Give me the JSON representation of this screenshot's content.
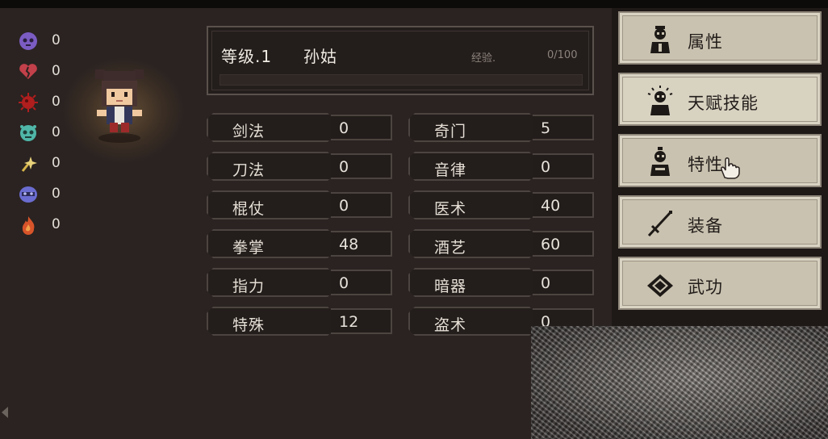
{
  "status_counters": [
    {
      "icon": "purple-skull-icon",
      "color": "#7b5cc2",
      "value": "0"
    },
    {
      "icon": "broken-heart-icon",
      "color": "#c2404a",
      "value": "0"
    },
    {
      "icon": "red-virus-icon",
      "color": "#b01e1e",
      "value": "0"
    },
    {
      "icon": "teal-skull-icon",
      "color": "#4fb6a8",
      "value": "0"
    },
    {
      "icon": "yellow-sparkle-icon",
      "color": "#d6b44a",
      "value": "0"
    },
    {
      "icon": "blue-mask-icon",
      "color": "#6a6cd0",
      "value": "0"
    },
    {
      "icon": "orange-flame-icon",
      "color": "#d8542a",
      "value": "0"
    }
  ],
  "header": {
    "level": "等级.1",
    "name": "孙姑",
    "exp_label": "经验.",
    "exp_value": "0/100",
    "exp_progress": 0
  },
  "skills_left": [
    {
      "label": "剑法",
      "value": "0"
    },
    {
      "label": "刀法",
      "value": "0"
    },
    {
      "label": "棍仗",
      "value": "0"
    },
    {
      "label": "拳掌",
      "value": "48"
    },
    {
      "label": "指力",
      "value": "0"
    },
    {
      "label": "特殊",
      "value": "12"
    }
  ],
  "skills_right": [
    {
      "label": "奇门",
      "value": "5"
    },
    {
      "label": "音律",
      "value": "0"
    },
    {
      "label": "医术",
      "value": "40"
    },
    {
      "label": "酒艺",
      "value": "60"
    },
    {
      "label": "暗器",
      "value": "0"
    },
    {
      "label": "盗术",
      "value": "0"
    }
  ],
  "menu": [
    {
      "label": "属性",
      "icon": "person-icon"
    },
    {
      "label": "天赋技能",
      "icon": "person-glow-icon"
    },
    {
      "label": "特性",
      "icon": "person-trait-icon"
    },
    {
      "label": "装备",
      "icon": "sword-icon"
    },
    {
      "label": "武功",
      "icon": "book-icon"
    }
  ],
  "colors": {
    "panel_bg": "#2a2321",
    "menu_bg": "#c9c2b0",
    "text_light": "#e7e1d6"
  }
}
